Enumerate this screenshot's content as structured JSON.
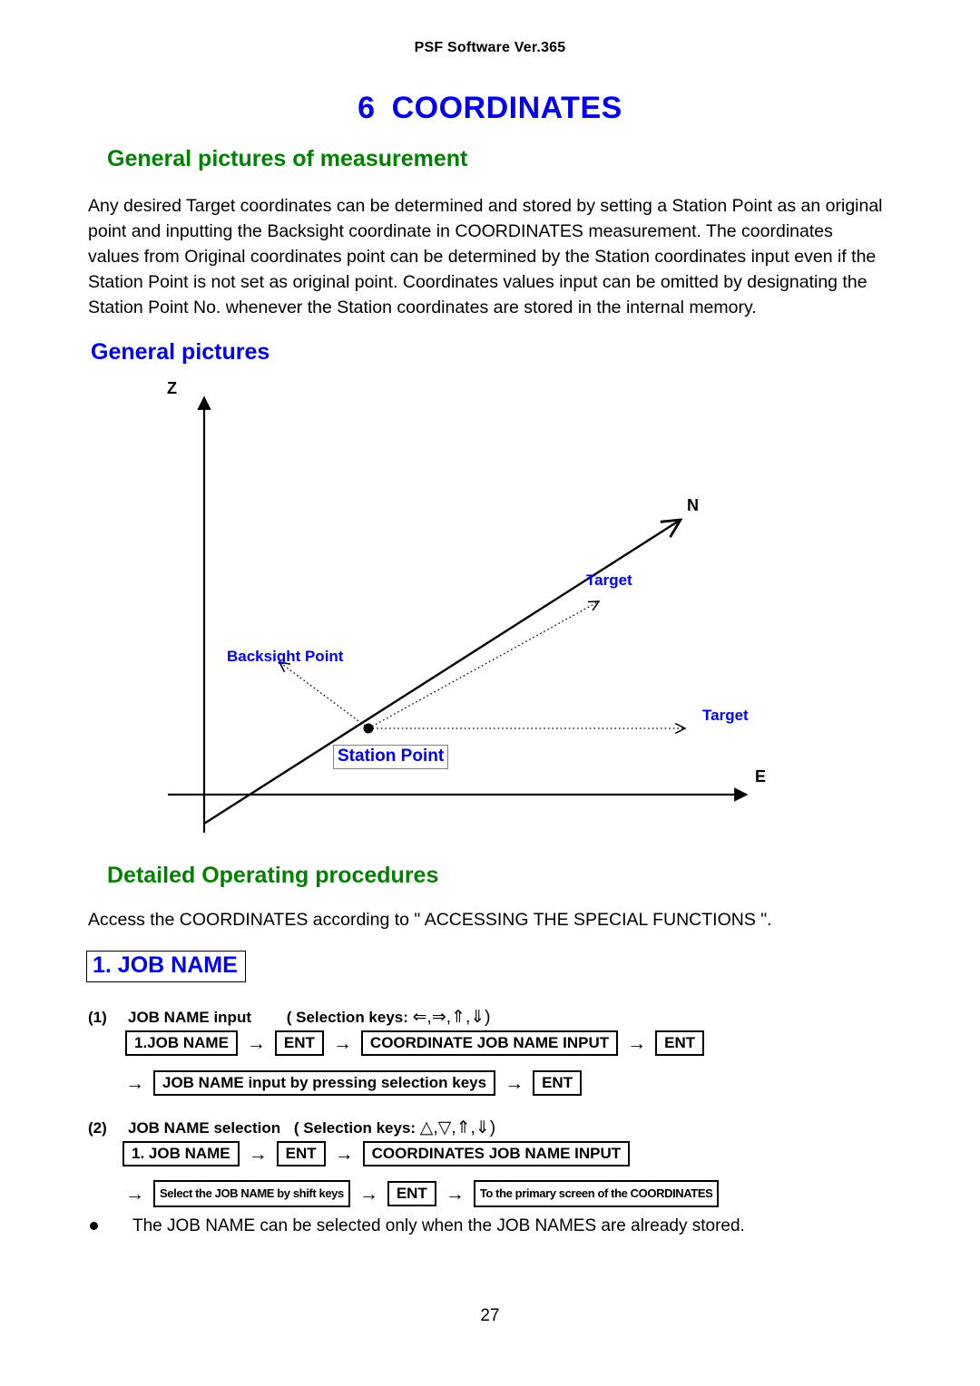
{
  "header": {
    "running_head": "PSF Software Ver.365"
  },
  "chapter": {
    "number": "6",
    "title": "COORDINATES"
  },
  "sections": {
    "general_measurement": "General pictures of measurement",
    "general_pictures": "General pictures",
    "detailed": "Detailed Operating procedures"
  },
  "paragraph": "Any desired Target coordinates can be determined and stored by setting a Station Point as an original point and inputting the Backsight coordinate in COORDINATES measurement. The coordinates values from Original coordinates point can be determined by the Station coordinates input even if the Station Point is not set as original point. Coordinates values input can be omitted by designating the Station Point No. whenever the Station coordinates are stored in the internal memory.",
  "access_line": "Access the COORDINATES according to \" ACCESSING THE SPECIAL FUNCTIONS \".",
  "diagram": {
    "axis_z": "Z",
    "axis_n": "N",
    "axis_e": "E",
    "target_upper": "Target",
    "target_lower": "Target",
    "backsight": "Backsight Point",
    "station": "Station Point",
    "colors": {
      "label": "#0000ee",
      "axis": "#000000"
    }
  },
  "job_name_heading": "1. JOB NAME",
  "procedures": [
    {
      "index": "(1)",
      "title": "JOB NAME input",
      "keys_label": "( Selection keys:",
      "keys_glyphs": "⇐,⇒,⇑,⇓",
      "keys_close": ")",
      "rows": [
        {
          "lead_arrow": "",
          "items": [
            "1.JOB NAME",
            "ENT",
            "COORDINATE JOB NAME INPUT",
            "ENT"
          ],
          "separator": "→",
          "small": false
        },
        {
          "lead_arrow": "→",
          "items": [
            "JOB NAME input by pressing selection keys",
            "ENT"
          ],
          "separator": "→",
          "small": false
        }
      ]
    },
    {
      "index": "(2)",
      "title": "JOB NAME selection",
      "keys_label": "( Selection keys:",
      "keys_glyphs": "△,▽,⇑,⇓",
      "keys_close": ")",
      "rows": [
        {
          "lead_arrow": "",
          "items": [
            "1. JOB NAME",
            "ENT",
            "COORDINATES JOB NAME INPUT"
          ],
          "separator": "→",
          "small": false
        },
        {
          "lead_arrow": "→",
          "items": [
            "Select the JOB NAME by shift keys",
            "ENT",
            "To the primary screen of the COORDINATES"
          ],
          "separator": "→",
          "small": true
        }
      ]
    }
  ],
  "note": "The JOB NAME can be selected only when the JOB NAMES are already stored.",
  "page_number": "27"
}
